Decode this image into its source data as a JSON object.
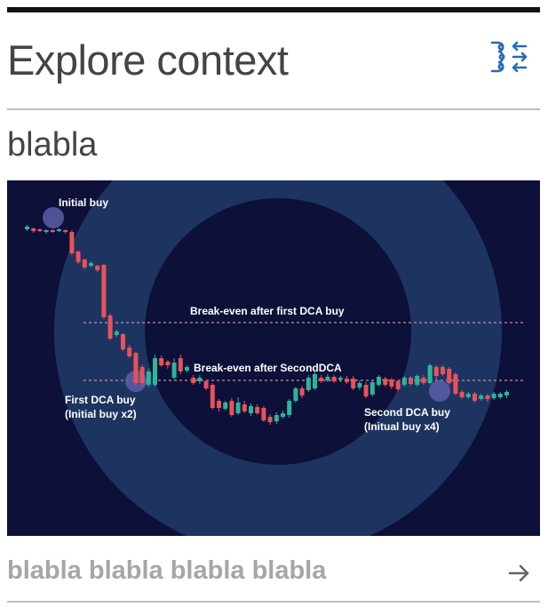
{
  "header": {
    "title": "Explore context",
    "filter_icon": "filter-arrows-icon"
  },
  "section": {
    "subtitle": "blabla"
  },
  "chart_data": {
    "type": "candlestick",
    "annotations": {
      "initial_buy": "Initial buy",
      "breakeven_first": "Break-even after first DCA buy",
      "breakeven_second": "Break-even after SecondDCA",
      "first_dca_line1": "First DCA buy",
      "first_dca_line2": "(Initial buy x2)",
      "second_dca_line1": "Second DCA buy",
      "second_dca_line2": "(Initual buy x4)"
    },
    "colors": {
      "background": "#0d1039",
      "ring": "#1d3461",
      "up": "#2bb59b",
      "down": "#e8525a",
      "marker": "#5b5fa8",
      "dashed": "#c98f95"
    },
    "candles": [
      {
        "o": 52,
        "c": 55,
        "h": 57,
        "l": 50,
        "up": true
      },
      {
        "o": 54,
        "c": 57,
        "h": 59,
        "l": 53,
        "up": false
      },
      {
        "o": 55,
        "c": 57,
        "h": 58,
        "l": 54,
        "up": false
      },
      {
        "o": 56,
        "c": 58,
        "h": 60,
        "l": 55,
        "up": true
      },
      {
        "o": 56,
        "c": 57,
        "h": 59,
        "l": 55,
        "up": false
      },
      {
        "o": 55,
        "c": 56,
        "h": 58,
        "l": 54,
        "up": true
      },
      {
        "o": 56,
        "c": 57,
        "h": 60,
        "l": 55,
        "up": false
      },
      {
        "o": 58,
        "c": 82,
        "h": 84,
        "l": 56,
        "up": false
      },
      {
        "o": 80,
        "c": 92,
        "h": 94,
        "l": 79,
        "up": false
      },
      {
        "o": 89,
        "c": 98,
        "h": 100,
        "l": 88,
        "up": false
      },
      {
        "o": 93,
        "c": 96,
        "h": 98,
        "l": 91,
        "up": true
      },
      {
        "o": 96,
        "c": 101,
        "h": 103,
        "l": 95,
        "up": false
      },
      {
        "o": 95,
        "c": 154,
        "h": 156,
        "l": 94,
        "up": false
      },
      {
        "o": 152,
        "c": 178,
        "h": 180,
        "l": 150,
        "up": false
      },
      {
        "o": 170,
        "c": 174,
        "h": 176,
        "l": 168,
        "up": true
      },
      {
        "o": 173,
        "c": 190,
        "h": 192,
        "l": 172,
        "up": false
      },
      {
        "o": 188,
        "c": 198,
        "h": 200,
        "l": 185,
        "up": false
      },
      {
        "o": 194,
        "c": 228,
        "h": 230,
        "l": 193,
        "up": false
      },
      {
        "o": 210,
        "c": 228,
        "h": 232,
        "l": 207,
        "up": false
      },
      {
        "o": 215,
        "c": 230,
        "h": 233,
        "l": 212,
        "up": true
      },
      {
        "o": 200,
        "c": 230,
        "h": 232,
        "l": 196,
        "up": true
      },
      {
        "o": 200,
        "c": 208,
        "h": 210,
        "l": 197,
        "up": false
      },
      {
        "o": 204,
        "c": 208,
        "h": 212,
        "l": 202,
        "up": false
      },
      {
        "o": 205,
        "c": 222,
        "h": 224,
        "l": 200,
        "up": true
      },
      {
        "o": 200,
        "c": 215,
        "h": 218,
        "l": 196,
        "up": false
      },
      {
        "o": 210,
        "c": 214,
        "h": 216,
        "l": 208,
        "up": true
      },
      {
        "o": 222,
        "c": 228,
        "h": 230,
        "l": 219,
        "up": false
      },
      {
        "o": 222,
        "c": 226,
        "h": 229,
        "l": 219,
        "up": true
      },
      {
        "o": 226,
        "c": 234,
        "h": 236,
        "l": 224,
        "up": false
      },
      {
        "o": 230,
        "c": 256,
        "h": 258,
        "l": 228,
        "up": false
      },
      {
        "o": 248,
        "c": 256,
        "h": 260,
        "l": 246,
        "up": false
      },
      {
        "o": 250,
        "c": 257,
        "h": 259,
        "l": 248,
        "up": true
      },
      {
        "o": 248,
        "c": 264,
        "h": 266,
        "l": 245,
        "up": false
      },
      {
        "o": 250,
        "c": 262,
        "h": 264,
        "l": 244,
        "up": true
      },
      {
        "o": 252,
        "c": 260,
        "h": 262,
        "l": 248,
        "up": false
      },
      {
        "o": 254,
        "c": 262,
        "h": 265,
        "l": 251,
        "up": true
      },
      {
        "o": 255,
        "c": 262,
        "h": 264,
        "l": 252,
        "up": false
      },
      {
        "o": 256,
        "c": 270,
        "h": 272,
        "l": 254,
        "up": false
      },
      {
        "o": 266,
        "c": 272,
        "h": 275,
        "l": 263,
        "up": false
      },
      {
        "o": 264,
        "c": 271,
        "h": 274,
        "l": 261,
        "up": true
      },
      {
        "o": 262,
        "c": 266,
        "h": 268,
        "l": 259,
        "up": true
      },
      {
        "o": 248,
        "c": 264,
        "h": 267,
        "l": 246,
        "up": true
      },
      {
        "o": 234,
        "c": 248,
        "h": 250,
        "l": 232,
        "up": true
      },
      {
        "o": 234,
        "c": 242,
        "h": 245,
        "l": 231,
        "up": false
      },
      {
        "o": 222,
        "c": 236,
        "h": 238,
        "l": 219,
        "up": true
      },
      {
        "o": 218,
        "c": 234,
        "h": 236,
        "l": 215,
        "up": true
      },
      {
        "o": 222,
        "c": 226,
        "h": 228,
        "l": 219,
        "up": false
      },
      {
        "o": 221,
        "c": 225,
        "h": 227,
        "l": 218,
        "up": true
      },
      {
        "o": 221,
        "c": 226,
        "h": 228,
        "l": 219,
        "up": false
      },
      {
        "o": 222,
        "c": 224,
        "h": 227,
        "l": 220,
        "up": true
      },
      {
        "o": 223,
        "c": 227,
        "h": 229,
        "l": 220,
        "up": false
      },
      {
        "o": 223,
        "c": 234,
        "h": 236,
        "l": 220,
        "up": false
      },
      {
        "o": 228,
        "c": 233,
        "h": 236,
        "l": 225,
        "up": true
      },
      {
        "o": 230,
        "c": 243,
        "h": 245,
        "l": 227,
        "up": false
      },
      {
        "o": 227,
        "c": 241,
        "h": 243,
        "l": 225,
        "up": true
      },
      {
        "o": 221,
        "c": 230,
        "h": 232,
        "l": 219,
        "up": true
      },
      {
        "o": 223,
        "c": 230,
        "h": 232,
        "l": 221,
        "up": false
      },
      {
        "o": 224,
        "c": 232,
        "h": 235,
        "l": 222,
        "up": false
      },
      {
        "o": 226,
        "c": 235,
        "h": 237,
        "l": 224,
        "up": false
      },
      {
        "o": 222,
        "c": 230,
        "h": 232,
        "l": 220,
        "up": true
      },
      {
        "o": 222,
        "c": 229,
        "h": 231,
        "l": 220,
        "up": false
      },
      {
        "o": 220,
        "c": 230,
        "h": 232,
        "l": 218,
        "up": true
      },
      {
        "o": 222,
        "c": 228,
        "h": 230,
        "l": 219,
        "up": false
      },
      {
        "o": 208,
        "c": 228,
        "h": 230,
        "l": 206,
        "up": true
      },
      {
        "o": 210,
        "c": 220,
        "h": 224,
        "l": 208,
        "up": false
      },
      {
        "o": 210,
        "c": 218,
        "h": 220,
        "l": 208,
        "up": false
      },
      {
        "o": 212,
        "c": 228,
        "h": 230,
        "l": 210,
        "up": false
      },
      {
        "o": 218,
        "c": 240,
        "h": 242,
        "l": 216,
        "up": false
      },
      {
        "o": 238,
        "c": 244,
        "h": 246,
        "l": 236,
        "up": false
      },
      {
        "o": 240,
        "c": 244,
        "h": 246,
        "l": 238,
        "up": true
      },
      {
        "o": 240,
        "c": 248,
        "h": 250,
        "l": 238,
        "up": false
      },
      {
        "o": 242,
        "c": 246,
        "h": 248,
        "l": 240,
        "up": true
      },
      {
        "o": 242,
        "c": 246,
        "h": 249,
        "l": 240,
        "up": false
      },
      {
        "o": 240,
        "c": 245,
        "h": 247,
        "l": 238,
        "up": true
      },
      {
        "o": 240,
        "c": 244,
        "h": 246,
        "l": 238,
        "up": true
      },
      {
        "o": 238,
        "c": 242,
        "h": 245,
        "l": 236,
        "up": true
      }
    ]
  },
  "footer": {
    "link_text": "blabla blabla blabla blabla",
    "arrow_icon": "arrow-right-icon"
  }
}
